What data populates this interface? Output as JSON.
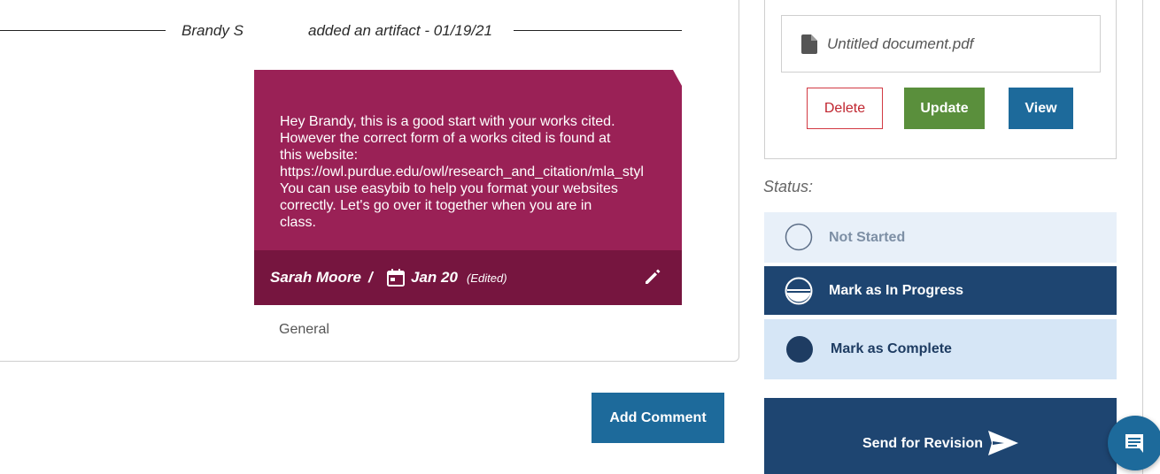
{
  "timeline": {
    "author": "Brandy S",
    "action": "added an artifact - 01/19/21"
  },
  "comment": {
    "lines": [
      "Hey Brandy, this is a good start with your works cited.",
      "However the correct form of a works cited is found at",
      "this website:",
      "https://owl.purdue.edu/owl/research_and_citation/mla_styl",
      "You can use easybib to help you format your websites",
      "correctly. Let's go over it together when you are in",
      "class."
    ],
    "author": "Sarah Moore",
    "separator": "/",
    "date": "Jan 20",
    "edited": "(Edited)",
    "category": "General"
  },
  "actions": {
    "add_comment": "Add Comment"
  },
  "artifact": {
    "file_name": "Untitled document.pdf",
    "delete_label": "Delete",
    "update_label": "Update",
    "view_label": "View"
  },
  "status": {
    "label": "Status:",
    "options": [
      {
        "label": "Not Started"
      },
      {
        "label": "Mark as In Progress"
      },
      {
        "label": "Mark as Complete"
      }
    ],
    "send_label": "Send for Revision"
  },
  "icons": {
    "calendar": "calendar-icon",
    "edit": "pencil-icon",
    "file": "file-icon",
    "send": "send-arrow-icon",
    "chat": "chat-icon"
  },
  "colors": {
    "comment_bg": "#9a2156",
    "comment_footer": "#76153f",
    "primary": "#1d6a9b",
    "update": "#5a8f3c",
    "delete": "#c0252f",
    "status_dark": "#1e4571",
    "status_light": "#e8f0f9",
    "status_complete_bg": "#d6e6f6"
  }
}
